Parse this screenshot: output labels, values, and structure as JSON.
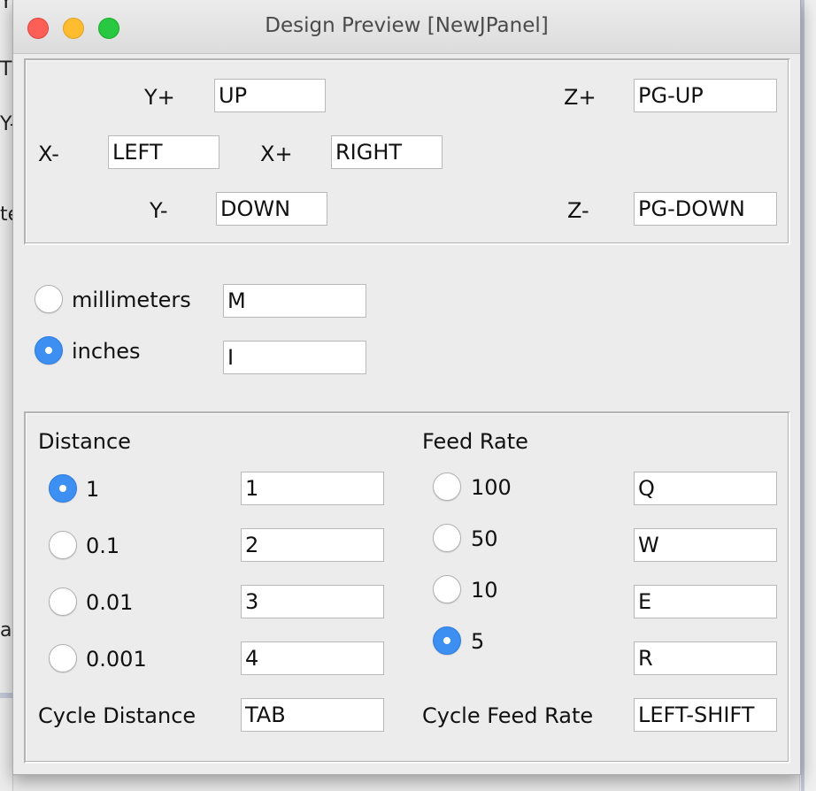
{
  "window": {
    "title": "Design Preview [NewJPanel]"
  },
  "background": {
    "fragments": [
      "Y+",
      "UP",
      "Z+",
      "PG-UP",
      "T",
      "Y-",
      "te",
      "ar"
    ]
  },
  "jog_keys": {
    "y_plus": {
      "label": "Y+",
      "value": "UP"
    },
    "z_plus": {
      "label": "Z+",
      "value": "PG-UP"
    },
    "x_minus": {
      "label": "X-",
      "value": "LEFT"
    },
    "x_plus": {
      "label": "X+",
      "value": "RIGHT"
    },
    "y_minus": {
      "label": "Y-",
      "value": "DOWN"
    },
    "z_minus": {
      "label": "Z-",
      "value": "PG-DOWN"
    }
  },
  "units": {
    "options": [
      {
        "label": "millimeters",
        "value": "M",
        "selected": false
      },
      {
        "label": "inches",
        "value": "I",
        "selected": true
      }
    ]
  },
  "distance": {
    "title": "Distance",
    "options": [
      {
        "label": "1",
        "value": "1",
        "selected": true
      },
      {
        "label": "0.1",
        "value": "2",
        "selected": false
      },
      {
        "label": "0.01",
        "value": "3",
        "selected": false
      },
      {
        "label": "0.001",
        "value": "4",
        "selected": false
      }
    ],
    "cycle_label": "Cycle Distance",
    "cycle_value": "TAB"
  },
  "feed_rate": {
    "title": "Feed Rate",
    "options": [
      {
        "label": "100",
        "value": "Q",
        "selected": false
      },
      {
        "label": "50",
        "value": "W",
        "selected": false
      },
      {
        "label": "10",
        "value": "E",
        "selected": false
      },
      {
        "label": "5",
        "value": "R",
        "selected": true
      }
    ],
    "cycle_label": "Cycle Feed Rate",
    "cycle_value": "LEFT-SHIFT"
  },
  "colors": {
    "accent": "#3d8ff2",
    "close": "#fd5f57",
    "minimize": "#febc2e",
    "maximize": "#28c840"
  }
}
